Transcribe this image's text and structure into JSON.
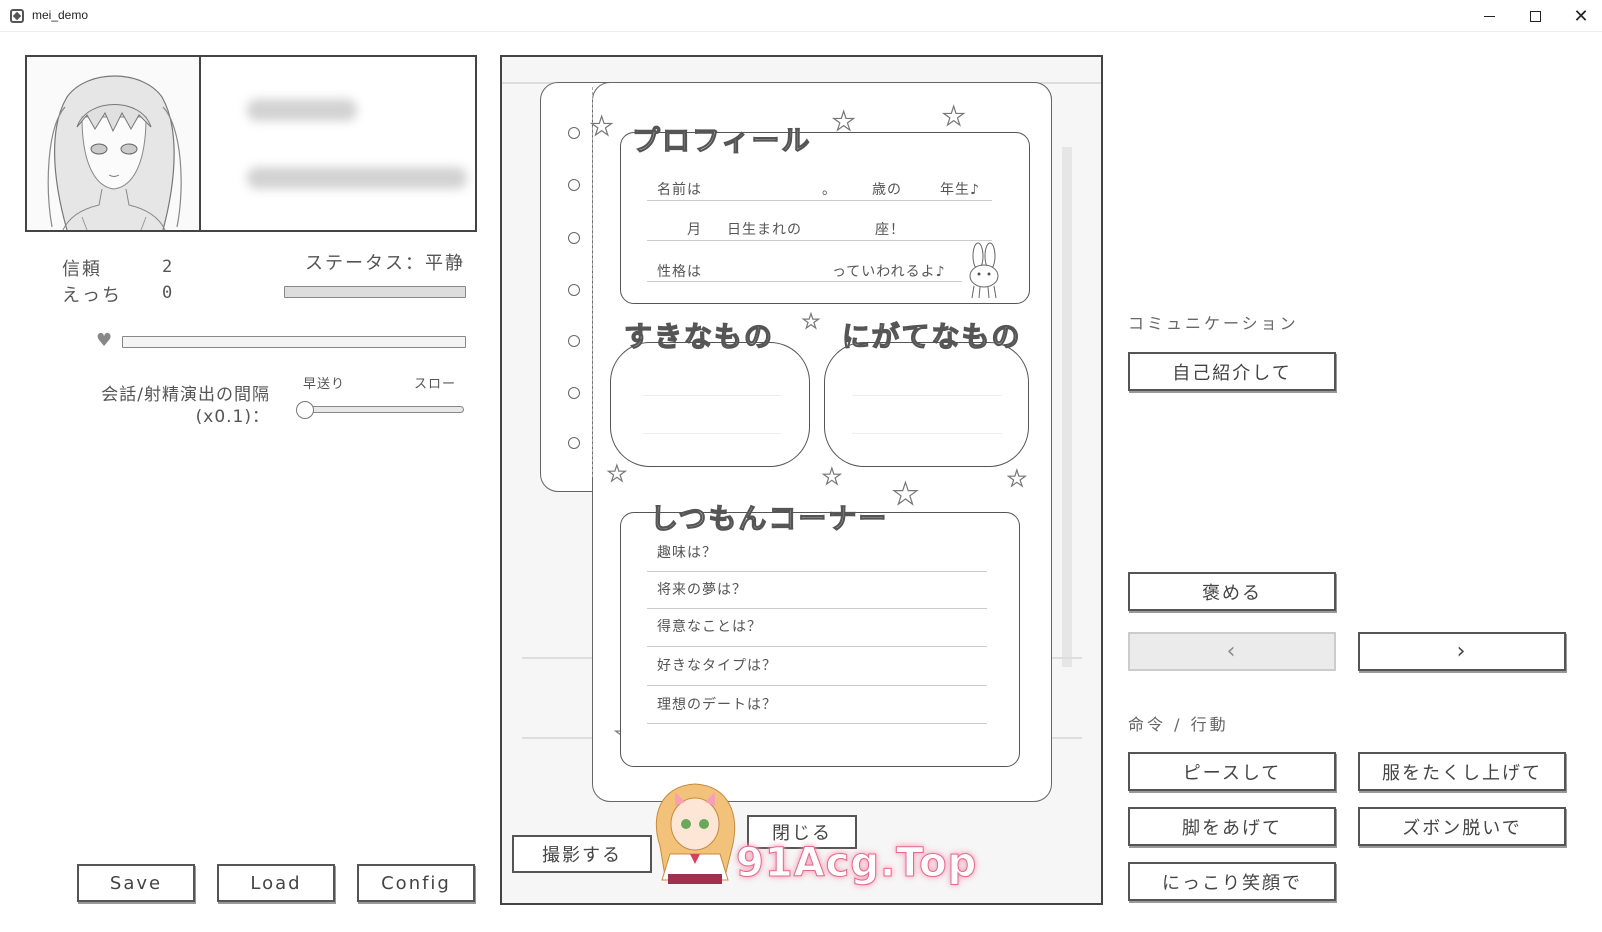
{
  "window": {
    "title": "mei_demo",
    "minimize_label": "",
    "maximize_label": "",
    "close_label": "✕"
  },
  "stats": {
    "trust_label": "信頼",
    "trust_value": "2",
    "ecchi_label": "えっち",
    "ecchi_value": "0",
    "status_label": "ステータス：平静",
    "heart_symbol": "♥",
    "interval_label_line1": "会話/射精演出の間隔",
    "interval_label_line2": "(x0.1)：",
    "fast_label": "早送り",
    "slow_label": "スロー"
  },
  "bottom_buttons": {
    "save": "Save",
    "load": "Load",
    "config": "Config"
  },
  "notebook": {
    "profile_title": "プロフィール",
    "name_prefix": "名前は",
    "name_dot": "。",
    "age_suffix": "歳の",
    "grade_suffix": "年生♪",
    "month_label": "月",
    "birthday_label": "日生まれの",
    "sign_label": "座！",
    "personality_prefix": "性格は",
    "personality_suffix": "っていわれるよ♪",
    "likes_title": "すきなもの",
    "dislikes_title": "にがてなもの",
    "questions_title": "しつもんコーナー",
    "questions": [
      "趣味は？",
      "将来の夢は？",
      "得意なことは？",
      "好きなタイプは？",
      "理想のデートは？"
    ],
    "photo_button": "撮影する",
    "close_button": "閉じる"
  },
  "watermark": "91Acg.Top",
  "right_panel": {
    "communication_label": "コミュニケーション",
    "self_intro_button": "自己紹介して",
    "praise_button": "褒める",
    "prev_button": "‹",
    "next_button": "›",
    "command_label": "命令 / 行動",
    "peace_button": "ピースして",
    "lift_clothes_button": "服をたくし上げて",
    "raise_legs_button": "脚をあげて",
    "pants_off_button": "ズボン脱いで",
    "smile_button": "にっこり笑顔で"
  },
  "colors": {
    "line": "#444444",
    "disabled_button": "#ebebeb",
    "watermark_pink": "#e36a8f"
  }
}
